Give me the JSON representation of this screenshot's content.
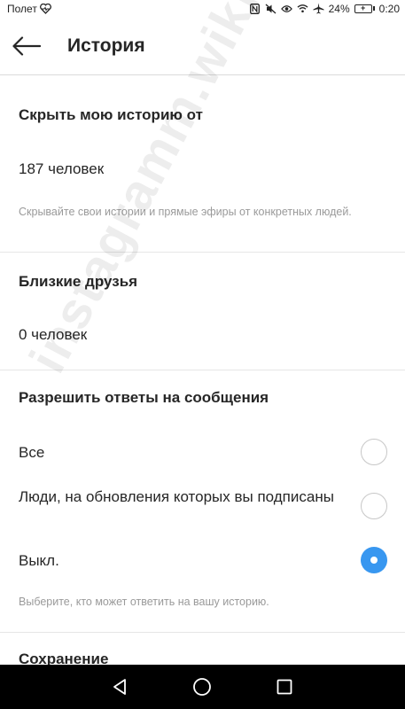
{
  "status_bar": {
    "carrier": "Полет",
    "battery": "24%",
    "time": "0:20",
    "icons": [
      "heart-pulse-icon",
      "nfc-icon",
      "mute-icon",
      "eye-icon",
      "wifi-icon",
      "airplane-icon",
      "battery-icon"
    ]
  },
  "header": {
    "title": "История",
    "back_icon": "arrow-left-icon"
  },
  "sections": {
    "hide_story": {
      "title": "Скрыть мою историю от",
      "value": "187 человек",
      "hint": "Скрывайте свои истории и прямые эфиры от конкретных людей."
    },
    "close_friends": {
      "title": "Близкие друзья",
      "value": "0 человек"
    },
    "replies": {
      "title": "Разрешить ответы на сообщения",
      "options": [
        {
          "label": "Все",
          "selected": false
        },
        {
          "label": "Люди, на обновления которых вы подписаны",
          "selected": false
        },
        {
          "label": "Выкл.",
          "selected": true
        }
      ],
      "hint": "Выберите, кто может ответить на вашу историю."
    },
    "saving": {
      "title": "Сохранение"
    }
  },
  "watermark": "instagramm.wiki",
  "nav_bar": {
    "icons": [
      "back-triangle-icon",
      "home-circle-icon",
      "recents-square-icon"
    ]
  },
  "colors": {
    "accent": "#3897f0",
    "text": "#262626",
    "hint": "#9a9a9a",
    "divider": "#e6e6e6"
  }
}
